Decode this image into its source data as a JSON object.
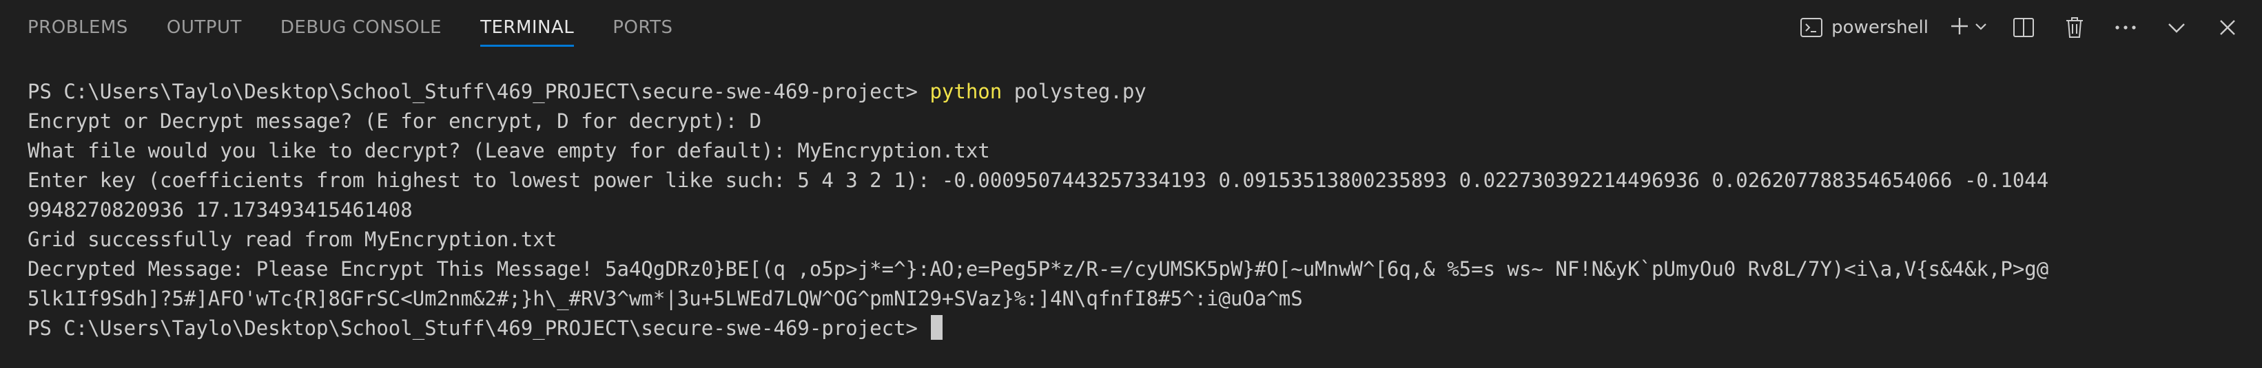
{
  "tabs": [
    {
      "label": "PROBLEMS"
    },
    {
      "label": "OUTPUT"
    },
    {
      "label": "DEBUG CONSOLE"
    },
    {
      "label": "TERMINAL",
      "active": true
    },
    {
      "label": "PORTS"
    }
  ],
  "toolbar": {
    "shell_label": "powershell",
    "icons": [
      "terminal-icon",
      "plus-icon",
      "chevron-down-icon",
      "split-icon",
      "trash-icon",
      "more-icon",
      "collapse-icon",
      "close-icon"
    ]
  },
  "terminal": {
    "prompt1": "PS C:\\Users\\Taylo\\Desktop\\School_Stuff\\469_PROJECT\\secure-swe-469-project> ",
    "cmd_python": "python",
    "cmd_args": " polysteg.py",
    "lines": [
      "Encrypt or Decrypt message? (E for encrypt, D for decrypt): D",
      "What file would you like to decrypt? (Leave empty for default): MyEncryption.txt",
      "Enter key (coefficients from highest to lowest power like such: 5 4 3 2 1): -0.0009507443257334193 0.09153513800235893 0.022730392214496936 0.026207788354654066 -0.1044",
      "9948270820936 17.173493415461408",
      "Grid successfully read from MyEncryption.txt",
      "Decrypted Message: Please Encrypt This Message! 5a4QgDRz0}BE[(q ,o5p>j*=^}:AO;e=Peg5P*z/R-=/cyUMSK5pW}#O[~uMnwW^[6q,& %5=s ws~ NF!N&yK`pUmyOu0 Rv8L/7Y)<i\\a,V{s&4&k,P>g@",
      "5lk1If9Sdh]?5#]AFO'wTc{R]8GFrSC<Um2nm&2#;}h\\_#RV3^wm*|3u+5LWEd7LQW^OG^pmNI29+SVaz}%:]4N\\qfnfI8#5^:i@uOa^mS"
    ],
    "prompt2": "PS C:\\Users\\Taylo\\Desktop\\School_Stuff\\469_PROJECT\\secure-swe-469-project> "
  },
  "colors": {
    "background": "#1f1f1f",
    "active_tab_underline": "#0078d4",
    "command_highlight": "#f1e34a"
  }
}
